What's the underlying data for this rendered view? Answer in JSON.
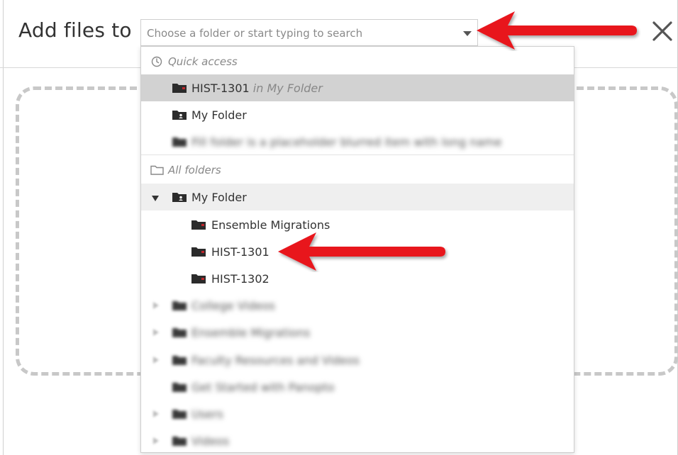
{
  "dialog": {
    "title": "Add files to",
    "close_glyph": "✕"
  },
  "folder_picker": {
    "placeholder": "Choose a folder or start typing to search",
    "sections": {
      "quick_access": "Quick access",
      "all_folders": "All folders"
    },
    "quick_access_items": [
      {
        "name": "HIST-1301",
        "location": "in My Folder",
        "state": "highlighted"
      },
      {
        "name": "My Folder"
      },
      {
        "name": "Fill folder is a placeholder blurred item with long name",
        "state": "blurred"
      }
    ],
    "all_folders": {
      "root": {
        "name": "My Folder",
        "expanded": true
      },
      "children": [
        {
          "name": "Ensemble Migrations"
        },
        {
          "name": "HIST-1301",
          "annotated": true
        },
        {
          "name": "HIST-1302"
        }
      ],
      "other_blurred": [
        {
          "name": "College Videos"
        },
        {
          "name": "Ensemble Migrations"
        },
        {
          "name": "Faculty Resources and Videos"
        },
        {
          "name": "Get Started with Panopto"
        },
        {
          "name": "Users"
        },
        {
          "name": "Videos"
        }
      ]
    }
  },
  "annotation_arrows": {
    "color": "#e8141a",
    "count": 2
  },
  "colors": {
    "folder_icon": "#2b2b2b",
    "folder_accent": "#c0262c",
    "highlight_row": "#d2d2d2",
    "border": "#cfcfcf",
    "dropzone_dash": "#c8c8c8"
  }
}
